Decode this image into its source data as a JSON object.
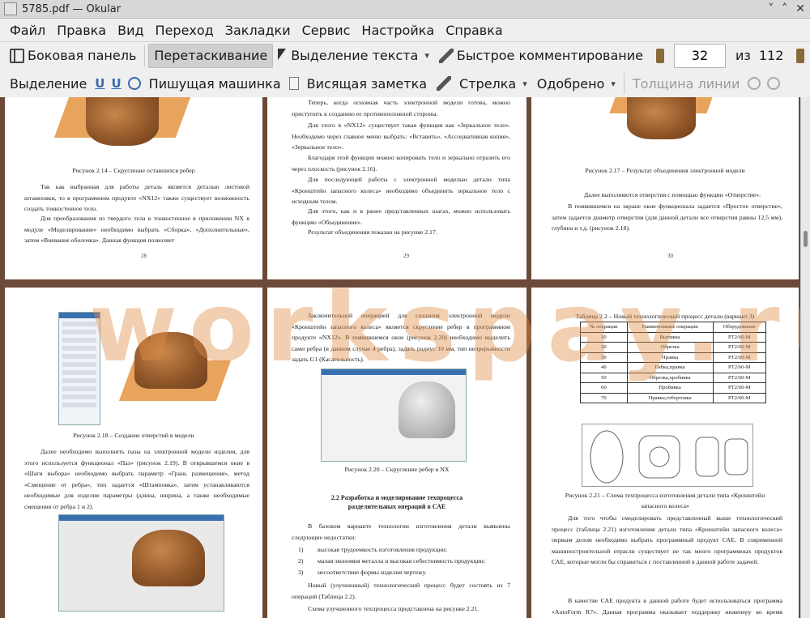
{
  "window": {
    "title": "5785.pdf  — Okular",
    "buttons": [
      "˅",
      "˄",
      "✕"
    ]
  },
  "menu": [
    "Файл",
    "Правка",
    "Вид",
    "Переход",
    "Закладки",
    "Сервис",
    "Настройка",
    "Справка"
  ],
  "toolbar1": {
    "sidebar": "Боковая панель",
    "drag": "Перетаскивание",
    "text_select": "Выделение текста",
    "quick_comment": "Быстрое комментирование",
    "page_current": "32",
    "page_of": "из",
    "page_total": "112"
  },
  "toolbar2": {
    "highlight": "Выделение",
    "typewriter": "Пишущая машинка",
    "sticky_note": "Висящая заметка",
    "arrow": "Стрелка",
    "approved": "Одобрено",
    "line_width": "Толщина линии"
  },
  "watermark": "workspay.ru",
  "pages": {
    "p28": {
      "caption": "Рисунок 2.14 – Скругление оставшихся ребер",
      "text": "Так как выбранная для работы деталь является деталью листовой штамповки, то в программном продукте «NX12» также существует возможность создать тонкостенное тело.",
      "text2": "Для преобразования из твердого тела в тонкостенное в приложении NX в модуле «Моделирование» необходимо выбрать «Сборка», «Дополнительные», затем «Вневание оболочка». Данная функция позволяет",
      "num": "28"
    },
    "p29": {
      "t1": "Теперь, когда основная часть электронной модели готова, можно приступить к созданию ее противоположной стороны.",
      "t2": "Для этого в «NX12» существует такая функция как «Зеркальное тело». Необходимо через главное меню выбрать: «Вставить», «Ассоциативная копия», «Зеркальное тело».",
      "t3": "Благодаря этой функции можно копировать тело и зеркально отразить его через плоскость (рисунок 2.16).",
      "t4": "Для последующей работы с электронной моделью детали типа «Кронштейн запасного колеса» необходимо объединить зеркальное тело с исходным телом.",
      "t5": "Для этого, как и в ранее представленных шагах, можно использовать функцию «Объединение».",
      "t6": "Результат объединения показан на рисунке 2.17.",
      "num": "29"
    },
    "p30": {
      "caption": "Рисунок 2.17 – Результат объединения электронной модели",
      "t1": "Далее выполняются отверстия с помощью функции «Отверстие».",
      "t2": "В появившемся на экране окне функционала задается «Простое отверстие», затем задается диаметр отверстия (для данной детали все отверстия равны 12,5 мм), глубина и т.д. (рисунок 2.18).",
      "num": "30"
    },
    "p31": {
      "caption": "Рисунок 2.18 – Создание отверстий в модели",
      "text": "Далее необходимо выполнить пазы на электронной модели изделия, для этого используется функционал «Паз» (рисунок 2.19). В открывшемся окне в «Шаги выбора» необходимо выбрать параметр «Грань размещения», метод «Смещение от ребра», тип задается «Штамповка», затем устанавливаются необходимые для изделия параметры (длина, ширина, а также необходимые смещения от ребра 1 и 2)."
    },
    "p32": {
      "t1": "Заключительной операцией для создания электронной модели «Кронштейн запасного колеса» является скругление ребер в программном продукте «NX12». В появившемся окне (рисунок 2.20) необходимо выделить сами ребра (в данном случае 4 ребра), задать радиус 10 мм, тип непрерывности задать G1 (Касательность).",
      "caption": "Рисунок 2.20 – Скругление ребер в NX",
      "heading": "2.2 Разработка и моделирование техпроцесса разделительных операций в САЕ",
      "t2": "В базовом варианте технологии изготовления детали выявлены следующие недостатки:",
      "l1": "высокая трудоемкость изготовления продукции;",
      "l2": "малая экономия металла и высокая себестоимость продукции;",
      "l3": "несоответствие формы изделия чертежу.",
      "n1": "1)",
      "n2": "2)",
      "n3": "3)",
      "t3": "Новый (улучшенный) технологический процесс будет состоять из 7 операций (Таблица 2.2).",
      "t4": "Схема улучшенного техпроцесса представлена на рисунке 2.21."
    },
    "p33": {
      "table_title": "Таблица 2.2 – Новый технологический процесс детали (вариант 3)",
      "table_header": [
        "№ операции",
        "Наименование операции",
        "Оборудование"
      ],
      "table_rows": [
        [
          "10",
          "Вытяжка",
          "PT2/60-M"
        ],
        [
          "20",
          "Обрезка",
          "PT2/60-M"
        ],
        [
          "30",
          "Правка",
          "PT2/60-M"
        ],
        [
          "40",
          "Гибка,правка",
          "PT2/60-M"
        ],
        [
          "50",
          "Обрезка,пробивка",
          "PT2/60-M"
        ],
        [
          "60",
          "Пробивка",
          "PT2/60-M"
        ],
        [
          "70",
          "Правка,отбортовка",
          "PT2/60-M"
        ]
      ],
      "caption": "Рисунок 2.21 – Схема техпроцесса изготовления детали типа «Кронштейн запасного колеса»",
      "t1": "Для того чтобы смоделировать представленный выше технологический процесс (таблица 2.21) изготовления детали типа «Кронштейн запасного колеса» первым делом необходимо выбрать программный продукт САЕ. В современной машиностроительной отрасли существует не так много программных продуктов САЕ, которые могли бы справиться с поставленной в данной работе задачей.",
      "t2": "В качестве САЕ продукта в данной работе будет использоваться программа «AutoForm R7». Данная программа оказывает поддержку инженеру во время проектирования детали с учетом обеспечения"
    }
  },
  "colors": {
    "background": "#6b4a38",
    "part": "#a0622f",
    "plate": "#e8a35c",
    "watermark": "#e08c46"
  }
}
